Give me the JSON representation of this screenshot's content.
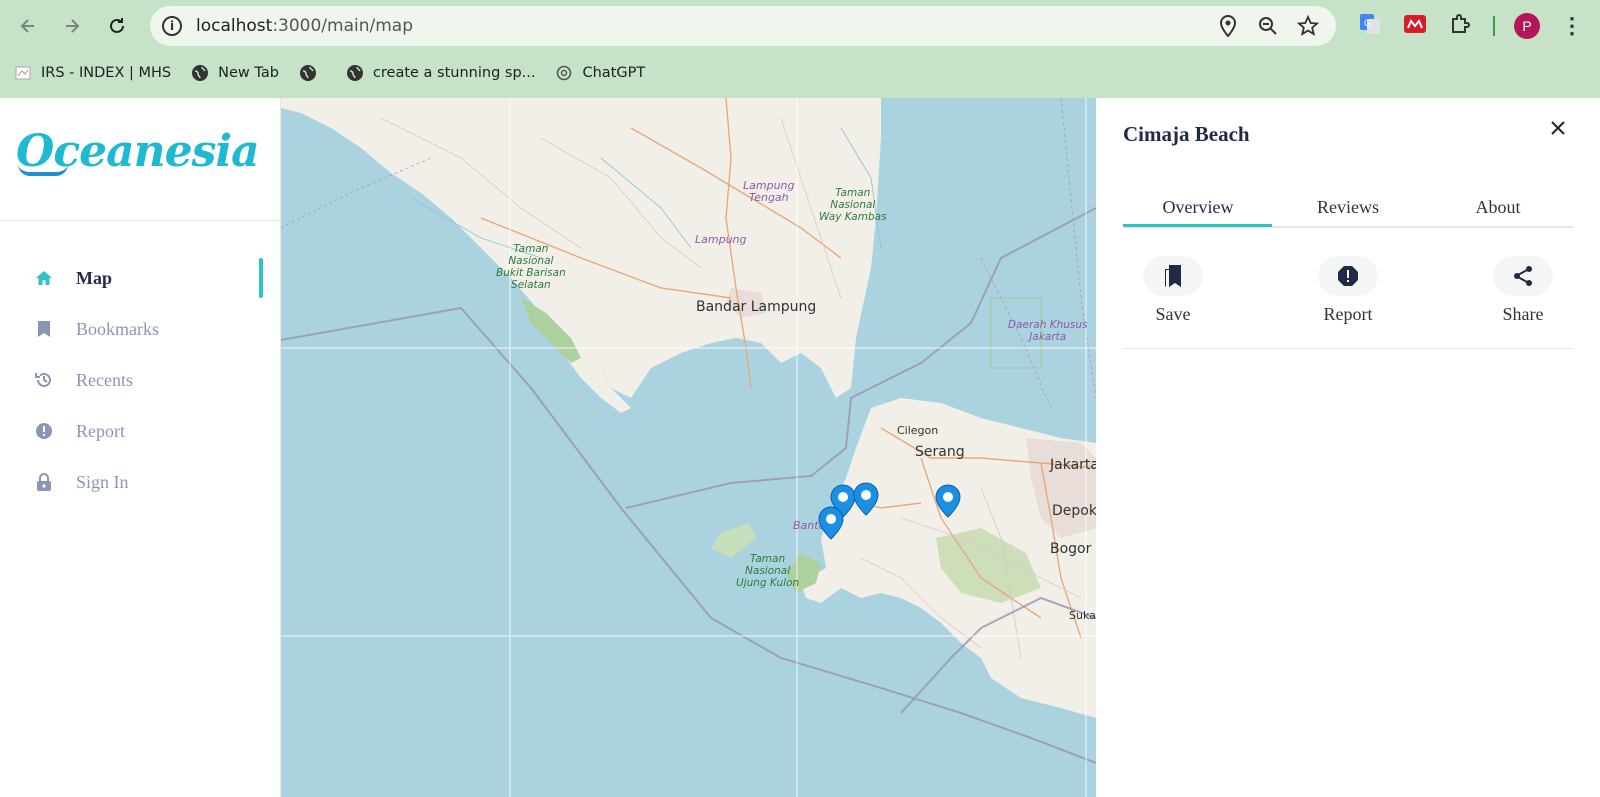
{
  "browser": {
    "url_host": "localhost",
    "url_path": ":3000/main/map",
    "profile_initial": "P",
    "bookmarks": [
      {
        "label": "IRS - INDEX | MHS",
        "icon": "page-icon"
      },
      {
        "label": "New Tab",
        "icon": "globe-icon"
      },
      {
        "label": "",
        "icon": "globe-icon"
      },
      {
        "label": "create a stunning sp...",
        "icon": "globe-icon"
      },
      {
        "label": "ChatGPT",
        "icon": "chatgpt-icon"
      }
    ]
  },
  "sidebar": {
    "logo_text": "Oceanesia",
    "items": [
      {
        "label": "Map",
        "icon": "home-icon",
        "active": true
      },
      {
        "label": "Bookmarks",
        "icon": "bookmark-icon",
        "active": false
      },
      {
        "label": "Recents",
        "icon": "history-icon",
        "active": false
      },
      {
        "label": "Report",
        "icon": "alert-icon",
        "active": false
      },
      {
        "label": "Sign In",
        "icon": "lock-icon",
        "active": false
      }
    ]
  },
  "map": {
    "labels": {
      "bandar_lampung": "Bandar Lampung",
      "serang": "Serang",
      "cilegon": "Cilegon",
      "jakarta": "Jakarta",
      "depok": "Depok",
      "bogor": "Bogor",
      "sukabumi": "Suka",
      "banten": "Banten",
      "lampung": "Lampung",
      "lampung_tengah": "Lampung\nTengah",
      "way_kambas": "Taman\nNasional\nWay Kambas",
      "bukit_barisan": "Taman\nNasional\nBukit Barisan\nSelatan",
      "ujung_kulon": "Taman\nNasional\nUjung Kulon",
      "dki_jakarta": "Daerah Khusus\nJakarta"
    },
    "marker_color": "#1a8fe3"
  },
  "panel": {
    "title": "Cimaja Beach",
    "tabs": [
      "Overview",
      "Reviews",
      "About"
    ],
    "active_tab": "Overview",
    "actions": [
      {
        "label": "Save",
        "icon": "bookmark-multiple-icon"
      },
      {
        "label": "Report",
        "icon": "alert-circle-icon"
      },
      {
        "label": "Share",
        "icon": "share-icon"
      }
    ]
  },
  "colors": {
    "accent": "#2ec4c4",
    "brand": "#1fb9d2",
    "chrome": "#c6e2c7",
    "water": "#aad3df",
    "land": "#f2efe9"
  }
}
